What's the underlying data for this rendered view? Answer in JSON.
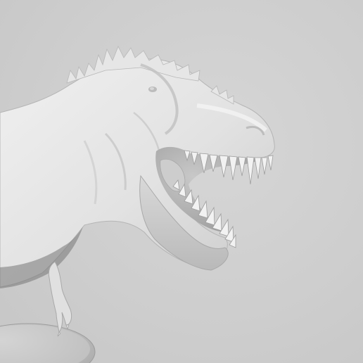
{
  "scene": {
    "subject": "t-rex-sculpt",
    "background_color": "#cfcfcf",
    "model_color": "#e4e4e4",
    "shadow_color": "#8a8a8a"
  }
}
